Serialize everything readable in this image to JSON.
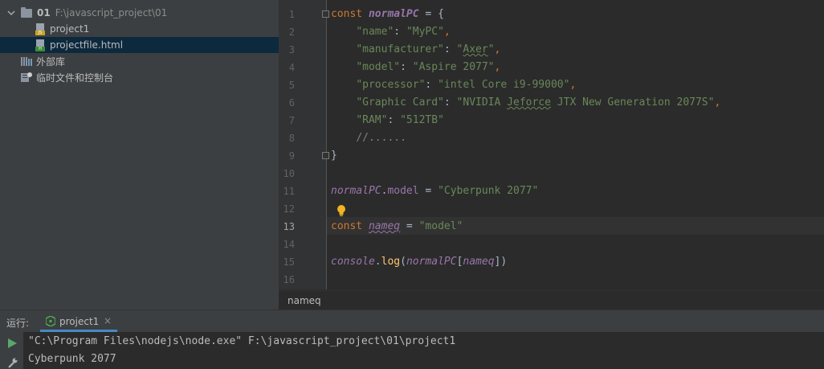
{
  "project_panel": {
    "root": {
      "name": "01",
      "path": "F:\\javascript_project\\01",
      "icon": "folder-icon"
    },
    "files": [
      {
        "name": "project1",
        "icon": "js-file-icon",
        "tag": "JS"
      },
      {
        "name": "projectfile.html",
        "icon": "html-file-icon",
        "tag": "H"
      }
    ],
    "external_libraries": "外部库",
    "scratches": "临时文件和控制台"
  },
  "editor": {
    "line_numbers": [
      "1",
      "2",
      "3",
      "4",
      "5",
      "6",
      "7",
      "8",
      "9",
      "10",
      "11",
      "12",
      "13",
      "14",
      "15",
      "16"
    ],
    "active_line": 13,
    "lines": {
      "l1": [
        "const",
        " ",
        "normalPC",
        " = {"
      ],
      "l2": [
        "\"name\"",
        ": ",
        "\"MyPC\"",
        ","
      ],
      "l3": [
        "\"manufacturer\"",
        ": ",
        "\"",
        "Axer",
        "\"",
        ","
      ],
      "l4": [
        "\"model\"",
        ": ",
        "\"Aspire 2077\"",
        ","
      ],
      "l5": [
        "\"processor\"",
        ": ",
        "\"intel Core i9-99000\"",
        ","
      ],
      "l6": [
        "\"Graphic Card\"",
        ": ",
        "\"NVIDIA ",
        "Jeforce",
        " JTX New Generation 2077S\"",
        ","
      ],
      "l7": [
        "\"RAM\"",
        ": ",
        "\"512TB\""
      ],
      "l8": [
        "//......"
      ],
      "l9": [
        "}"
      ],
      "l11": [
        "normalPC",
        ".",
        "model",
        " = ",
        "\"Cyberpunk 2077\""
      ],
      "l13": [
        "const",
        " ",
        "nameq",
        " = ",
        "\"model\""
      ],
      "l15": [
        "console",
        ".",
        "log",
        "(",
        "normalPC",
        "[",
        "nameq",
        "])"
      ]
    },
    "breadcrumb": "nameq"
  },
  "run_panel": {
    "label": "运行:",
    "tab": "project1",
    "tab_close": "×",
    "console_lines": [
      "\"C:\\Program Files\\nodejs\\node.exe\" F:\\javascript_project\\01\\project1",
      "Cyberpunk 2077"
    ]
  },
  "colors": {
    "keyword": "#cc7832",
    "variable": "#9876aa",
    "string": "#6a8759",
    "function": "#ffc66d",
    "comment": "#808080",
    "selection": "#0d293e",
    "accent": "#4a88c7"
  }
}
